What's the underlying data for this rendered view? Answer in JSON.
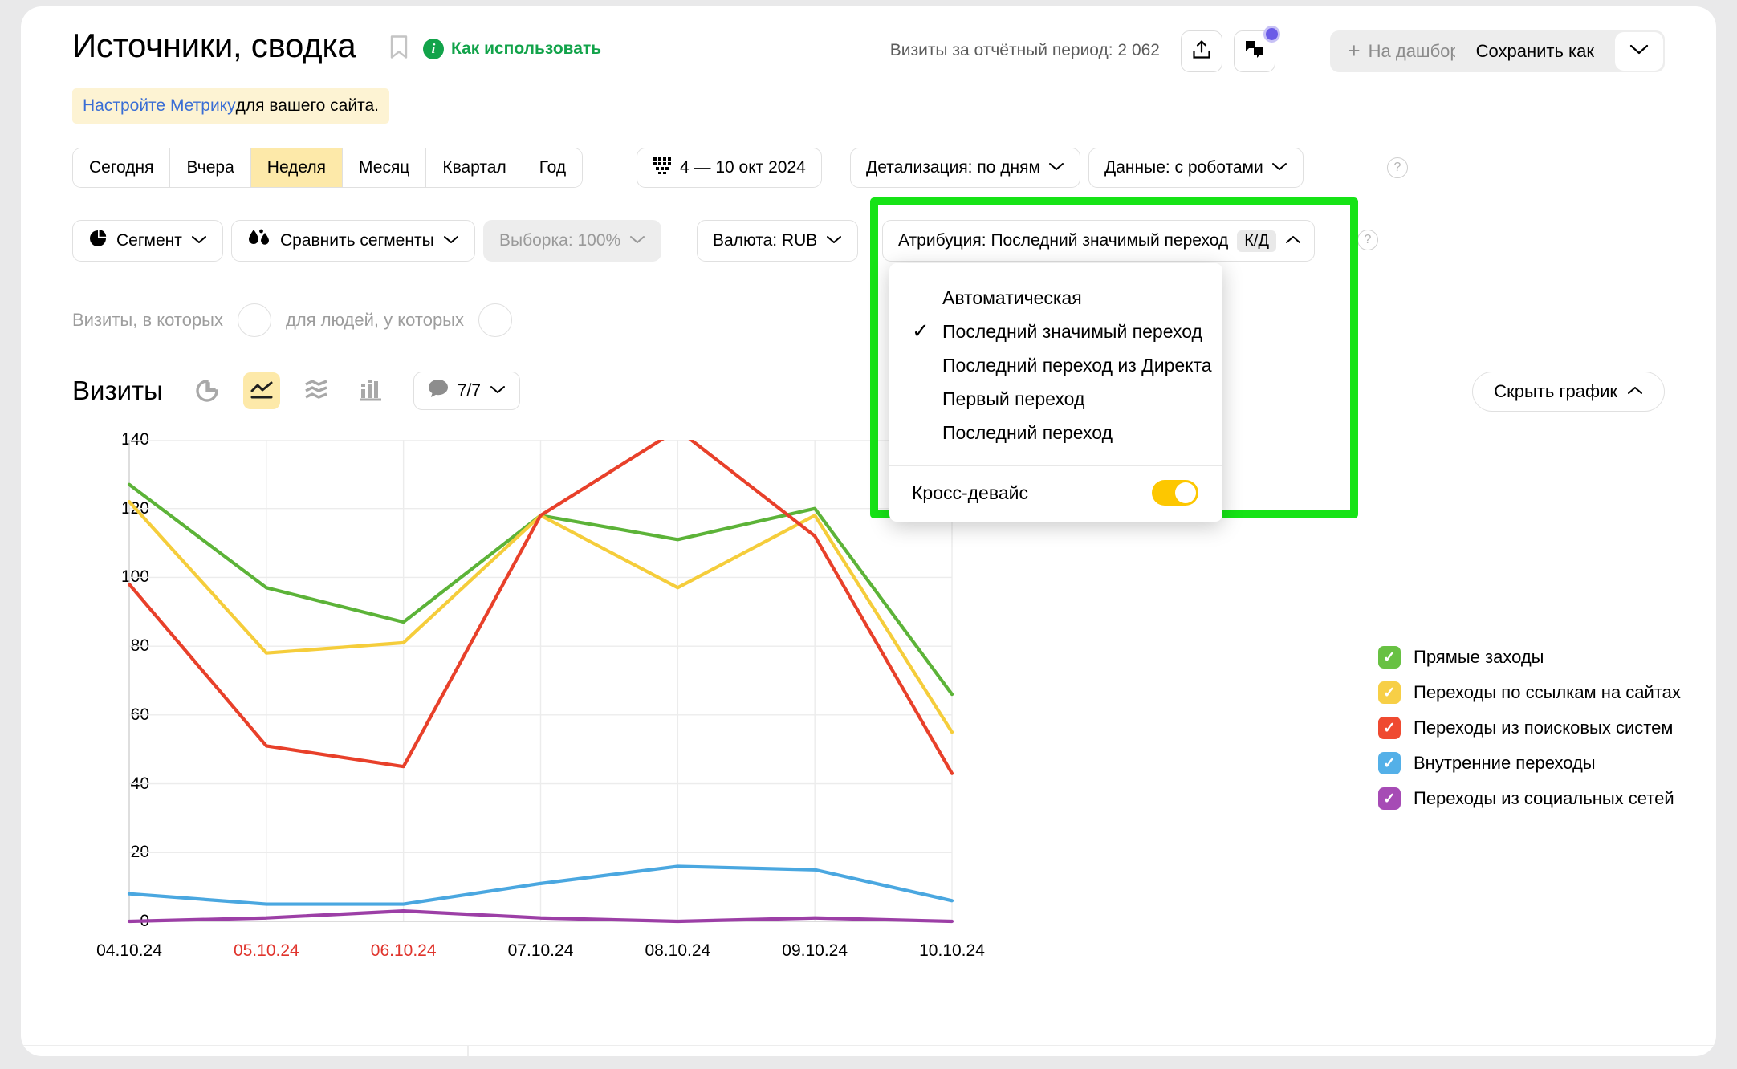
{
  "header": {
    "title": "Источники, сводка",
    "bookmark_icon": "bookmark-icon",
    "how_to_use": "Как использовать",
    "info_icon": "info-icon",
    "visits_summary": "Визиты за отчётный период: 2 062",
    "export_icon": "export-icon",
    "feedback_icon": "feedback-icon",
    "dashboard_label": "На дашборд",
    "dashboard_plus": "+",
    "save_as_label": "Сохранить как",
    "save_caret_icon": "chevron-down-icon"
  },
  "notice": {
    "link_text": "Настройте Метрику",
    "rest_text": " для вашего сайта."
  },
  "period_tabs": [
    {
      "label": "Сегодня",
      "active": false
    },
    {
      "label": "Вчера",
      "active": false
    },
    {
      "label": "Неделя",
      "active": true
    },
    {
      "label": "Месяц",
      "active": false
    },
    {
      "label": "Квартал",
      "active": false
    },
    {
      "label": "Год",
      "active": false
    }
  ],
  "filters_row1": {
    "date_range": "4 — 10 окт 2024",
    "calendar_icon": "calendar-icon",
    "detail": "Детализация: по дням",
    "data": "Данные: с роботами",
    "help_icon": "help-icon"
  },
  "filters_row2": {
    "segment": "Сегмент",
    "segment_icon": "pie-chart-icon",
    "compare": "Сравнить сегменты",
    "compare_icon": "compare-drops-icon",
    "sample": "Выборка: 100%",
    "currency": "Валюта: RUB",
    "attribution": "Атрибуция: Последний значимый переход",
    "attribution_chip": "К/Д",
    "attribution_caret_icon": "chevron-up-icon",
    "help_icon": "help-icon"
  },
  "attribution_dropdown": {
    "items": [
      {
        "label": "Автоматическая",
        "checked": false
      },
      {
        "label": "Последний значимый переход",
        "checked": true
      },
      {
        "label": "Последний переход из Директа",
        "checked": false
      },
      {
        "label": "Первый переход",
        "checked": false
      },
      {
        "label": "Последний переход",
        "checked": false
      }
    ],
    "check_glyph": "✓",
    "cross_device_label": "Кросс-девайс",
    "cross_device_on": true,
    "toggle_color": "#fdc700"
  },
  "visits_in_row": {
    "label_1": "Визиты, в которых",
    "label_2": "для людей, у которых"
  },
  "chart_header": {
    "title": "Визиты",
    "view_pie_icon": "pie-view-icon",
    "view_line_icon": "line-view-icon",
    "view_area_icon": "area-view-icon",
    "view_bar_icon": "bar-view-icon",
    "comment_icon": "comment-icon",
    "comment_count": "7/7",
    "comment_caret_icon": "chevron-down-icon",
    "hide_chart_label": "Скрыть график",
    "hide_chart_caret_icon": "chevron-up-icon"
  },
  "chart_data": {
    "type": "line",
    "title": "Визиты",
    "xlabel": "",
    "ylabel": "",
    "ylim": [
      0,
      140
    ],
    "yticks": [
      0,
      20,
      40,
      60,
      80,
      100,
      120,
      140
    ],
    "grid": true,
    "legend_position": "right",
    "categories": [
      "04.10.24",
      "05.10.24",
      "06.10.24",
      "07.10.24",
      "08.10.24",
      "09.10.24",
      "10.10.24"
    ],
    "weekend_categories": [
      "05.10.24",
      "06.10.24"
    ],
    "series": [
      {
        "name": "Прямые заходы",
        "color": "#5cb338",
        "values": [
          127,
          97,
          87,
          118,
          111,
          120,
          66
        ]
      },
      {
        "name": "Переходы по ссылкам на сайтах",
        "color": "#f5cd3b",
        "values": [
          122,
          78,
          81,
          118,
          97,
          118,
          55
        ]
      },
      {
        "name": "Переходы из поисковых систем",
        "color": "#e8402a",
        "values": [
          98,
          51,
          45,
          118,
          143,
          112,
          43
        ]
      },
      {
        "name": "Внутренние переходы",
        "color": "#4aa7e0",
        "values": [
          8,
          5,
          5,
          11,
          16,
          15,
          6
        ]
      },
      {
        "name": "Переходы из социальных сетей",
        "color": "#9c3fa6",
        "values": [
          0,
          1,
          3,
          1,
          0,
          1,
          0
        ]
      }
    ]
  },
  "legend": {
    "check_glyph": "✓",
    "items": [
      {
        "label": "Прямые заходы",
        "color": "#68c143",
        "checked": true
      },
      {
        "label": "Переходы по ссылкам на сайтах",
        "color": "#f7cf46",
        "checked": true
      },
      {
        "label": "Переходы из поисковых систем",
        "color": "#ef4a30",
        "checked": true
      },
      {
        "label": "Внутренние переходы",
        "color": "#54b0e8",
        "checked": true
      },
      {
        "label": "Переходы из социальных сетей",
        "color": "#a64bb5",
        "checked": true
      }
    ]
  }
}
